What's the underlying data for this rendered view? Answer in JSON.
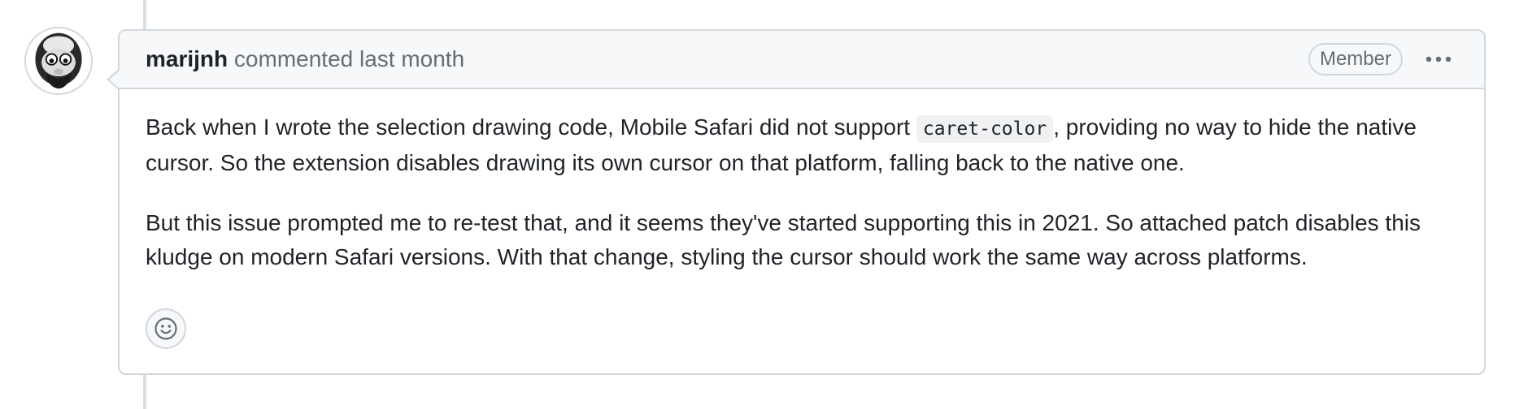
{
  "comment": {
    "author": "marijnh",
    "meta": "commented last month",
    "role_badge": "Member",
    "paragraph1_before": "Back when I wrote the selection drawing code, Mobile Safari did not support ",
    "paragraph1_code": "caret-color",
    "paragraph1_after": ", providing no way to hide the native cursor. So the extension disables drawing its own cursor on that platform, falling back to the native one.",
    "paragraph2": "But this issue prompted me to re-test that, and it seems they've started supporting this in 2021. So attached patch disables this kludge on modern Safari versions. With that change, styling the cursor should work the same way across platforms.",
    "avatar_icon": "avatar",
    "menu_icon": "kebab-horizontal-icon",
    "reaction_icon": "smiley-icon"
  },
  "colors": {
    "border": "#d0d7de",
    "header_bg": "#f6f8fa",
    "text": "#1f2328",
    "muted": "#656d76",
    "code_bg": "#eff1f3"
  }
}
